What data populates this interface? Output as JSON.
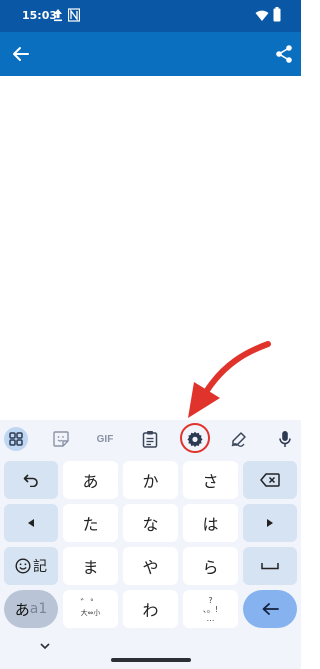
{
  "status_bar": {
    "time": "15:03"
  },
  "toolbar": {
    "gif_label": "GIF"
  },
  "keyboard": {
    "row1": {
      "k2": "あ",
      "k3": "か",
      "k4": "さ"
    },
    "row2": {
      "k2": "た",
      "k3": "な",
      "k4": "は"
    },
    "row3": {
      "emoji_label": "記",
      "k2": "ま",
      "k3": "や",
      "k4": "ら"
    },
    "row4": {
      "mode_kana": "あ",
      "mode_alpha": "a1",
      "k2_top": "゛゜",
      "k2_bottom": "大⇔小",
      "k3": "わ",
      "k4_top": "?",
      "k4_mid": "、。!",
      "k4_bottom": "…"
    }
  },
  "colors": {
    "status_bar": "#0a57a5",
    "app_bar": "#0b6fc0",
    "annotation": "#e0332b",
    "keyboard_bg": "#f1f4fa"
  }
}
